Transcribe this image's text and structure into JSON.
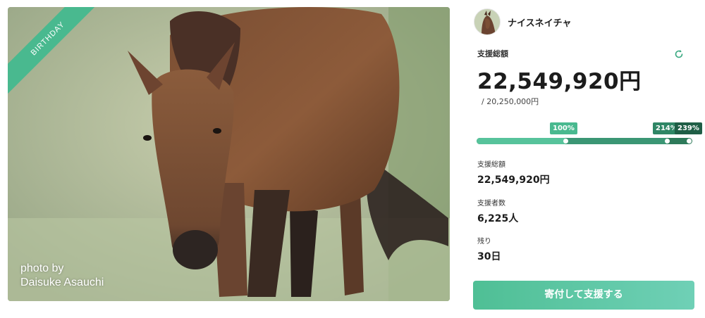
{
  "hero": {
    "ribbon_label": "BIRTHDAY",
    "credit_line1": "photo by",
    "credit_line2": "Daisuke Asauchi"
  },
  "owner": {
    "name": "ナイスネイチャ",
    "avatar_icon": "horse-avatar"
  },
  "funding": {
    "total_label": "支援総額",
    "total_amount": "22,549,920円",
    "goal": "/ 20,250,000円",
    "reload_icon": "reload-icon"
  },
  "progress": {
    "tags": [
      "100%",
      "214%",
      "239%"
    ],
    "values_percent": [
      100,
      214,
      239
    ],
    "colors": {
      "seg_first": "#57c39b",
      "seg_second": "#3b9674",
      "seg_third": "#2e7a5a"
    }
  },
  "stats": [
    {
      "label": "支援総額",
      "value": "22,549,920円"
    },
    {
      "label": "支援者数",
      "value": "6,225人"
    },
    {
      "label": "残り",
      "value": "30日"
    }
  ],
  "cta": {
    "label": "寄付して支援する"
  }
}
